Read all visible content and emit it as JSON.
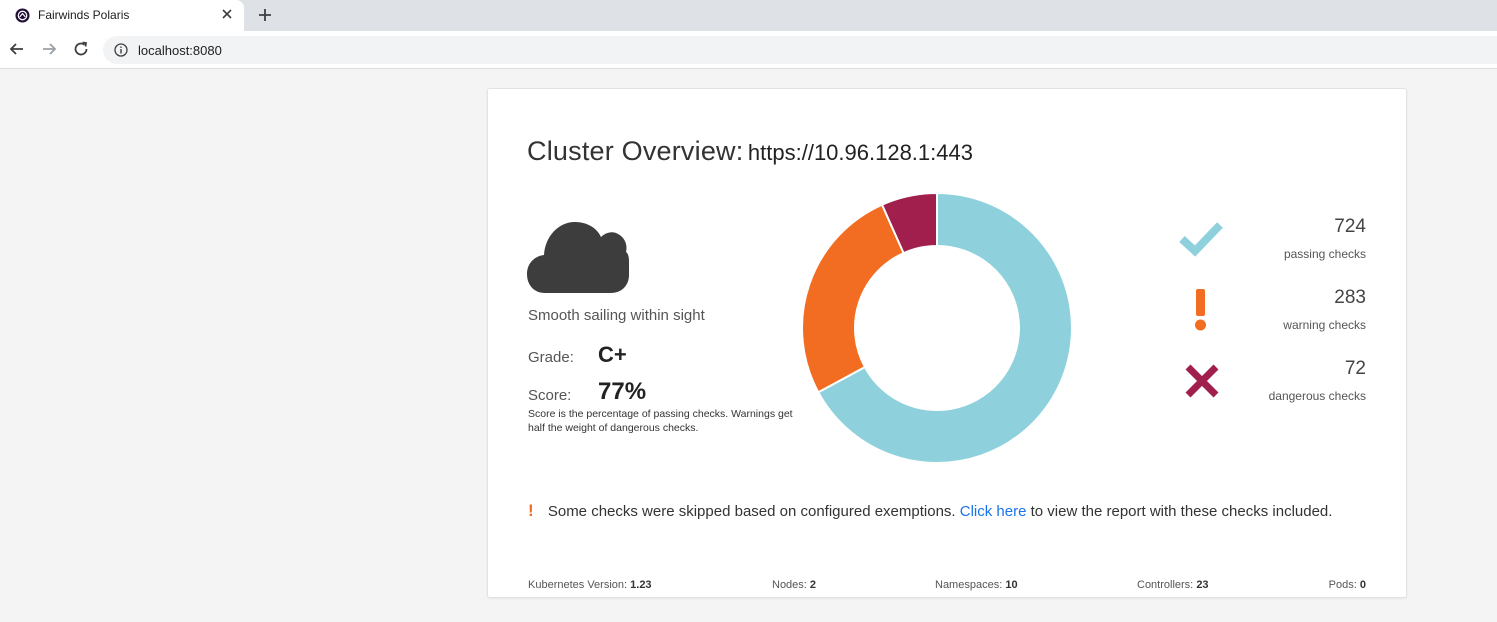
{
  "browser": {
    "tab_title": "Fairwinds Polaris",
    "url": "localhost:8080"
  },
  "overview": {
    "title_label": "Cluster Overview:",
    "cluster_url": "https://10.96.128.1:443",
    "summary": "Smooth sailing within sight",
    "grade_label": "Grade:",
    "grade": "C+",
    "score_label": "Score:",
    "score": "77%",
    "score_note": "Score is the percentage of passing checks. Warnings get half the weight of dangerous checks."
  },
  "stats": {
    "passing": {
      "count": "724",
      "label": "passing checks",
      "color": "#8ed1dc"
    },
    "warning": {
      "count": "283",
      "label": "warning checks",
      "color": "#f26c21"
    },
    "danger": {
      "count": "72",
      "label": "dangerous checks",
      "color": "#a11f4c"
    }
  },
  "chart_data": {
    "type": "pie",
    "categories": [
      "passing",
      "warning",
      "dangerous"
    ],
    "values": [
      724,
      283,
      72
    ],
    "colors": [
      "#8ed1dc",
      "#f26c21",
      "#a11f4c"
    ]
  },
  "notice": {
    "text_before": "Some checks were skipped based on configured exemptions.",
    "link": "Click here",
    "text_after": "to view the report with these checks included."
  },
  "footer": {
    "k8s_label": "Kubernetes Version:",
    "k8s_value": "1.23",
    "nodes_label": "Nodes:",
    "nodes_value": "2",
    "namespaces_label": "Namespaces:",
    "namespaces_value": "10",
    "controllers_label": "Controllers:",
    "controllers_value": "23",
    "pods_label": "Pods:",
    "pods_value": "0"
  }
}
